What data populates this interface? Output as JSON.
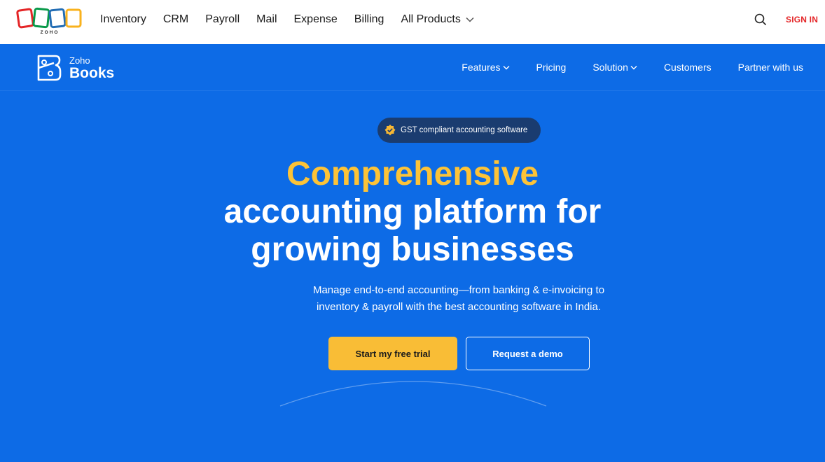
{
  "topbar": {
    "brand_logo_text": "ZOHO",
    "nav": [
      {
        "label": "Inventory"
      },
      {
        "label": "CRM"
      },
      {
        "label": "Payroll"
      },
      {
        "label": "Mail"
      },
      {
        "label": "Expense"
      },
      {
        "label": "Billing"
      },
      {
        "label": "All Products",
        "dropdown": true
      }
    ],
    "search_icon": "search-icon",
    "sign_in": "SIGN IN"
  },
  "product_header": {
    "logo_small": "Zoho",
    "logo_large": "Books",
    "nav": [
      {
        "label": "Features",
        "dropdown": true
      },
      {
        "label": "Pricing"
      },
      {
        "label": "Solution",
        "dropdown": true
      },
      {
        "label": "Customers"
      },
      {
        "label": "Partner with us"
      }
    ]
  },
  "hero": {
    "badge": "GST compliant accounting software",
    "badge_icon": "verified-badge-icon",
    "title_accent": "Comprehensive",
    "title_line2": "accounting platform for",
    "title_line3": "growing businesses",
    "subtitle_line1": "Manage end-to-end accounting—from banking & e-invoicing to",
    "subtitle_line2": "inventory & payroll with the best accounting software in India.",
    "primary_cta": "Start my free trial",
    "secondary_cta": "Request a demo"
  },
  "colors": {
    "hero_background": "#0d6be6",
    "accent_yellow": "#fdc337",
    "cta_yellow": "#f9bd36",
    "sign_in_red": "#e42527",
    "badge_background": "#1a3c70"
  }
}
